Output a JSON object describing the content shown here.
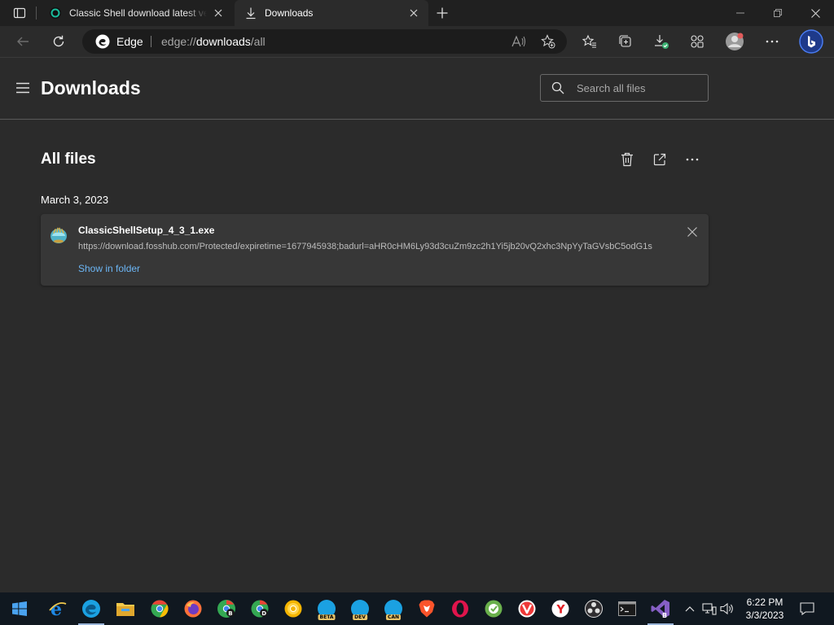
{
  "tabs": [
    {
      "title": "Classic Shell download latest version",
      "active": false
    },
    {
      "title": "Downloads",
      "active": true
    }
  ],
  "address": {
    "site_label": "Edge",
    "url_prefix": "edge://",
    "url_host": "downloads",
    "url_path": "/all"
  },
  "page": {
    "title": "Downloads",
    "search_placeholder": "Search all files",
    "section_title": "All files"
  },
  "downloads": {
    "date": "March 3, 2023",
    "items": [
      {
        "file_name": "ClassicShellSetup_4_3_1.exe",
        "url": "https://download.fosshub.com/Protected/expiretime=1677945938;badurl=aHR0cHM6Ly93d3cuZm9zc2h1Yi5jb20vQ2xhc3NpYyTaGVsbC5odG1s",
        "action_label": "Show in folder"
      }
    ]
  },
  "taskbar": {
    "apps": [
      {
        "name": "internet-explorer",
        "color": "#1e88e5"
      },
      {
        "name": "edge",
        "color": "#1ba1e2"
      },
      {
        "name": "file-explorer",
        "color": "#f2c94c"
      },
      {
        "name": "chrome",
        "color": "#34a853"
      },
      {
        "name": "firefox",
        "color": "#ff7139"
      },
      {
        "name": "chrome-beta",
        "color": "#34a853",
        "letter": "B"
      },
      {
        "name": "chrome-dev",
        "color": "#34a853",
        "letter": "D"
      },
      {
        "name": "chrome-canary",
        "color": "#f4b400"
      },
      {
        "name": "edge-beta",
        "color": "#1ba1e2",
        "badge": "BETA"
      },
      {
        "name": "edge-dev",
        "color": "#1ba1e2",
        "badge": "DEV"
      },
      {
        "name": "edge-canary",
        "color": "#1ba1e2",
        "badge": "CAN"
      },
      {
        "name": "brave",
        "color": "#fb542b"
      },
      {
        "name": "opera",
        "color": "#e0144c"
      },
      {
        "name": "coccoc",
        "color": "#6ab04c"
      },
      {
        "name": "vivaldi",
        "color": "#ef3939"
      },
      {
        "name": "yandex",
        "color": "#ffffff"
      },
      {
        "name": "obs",
        "color": "#302e31"
      },
      {
        "name": "terminal",
        "color": "#3a3a3a"
      },
      {
        "name": "visual-studio",
        "color": "#865fc5"
      }
    ],
    "clock_time": "6:22 PM",
    "clock_date": "3/3/2023"
  },
  "colors": {
    "accent_link": "#6cb6f5",
    "background": "#2b2b2b",
    "tab_strip": "#202020"
  }
}
